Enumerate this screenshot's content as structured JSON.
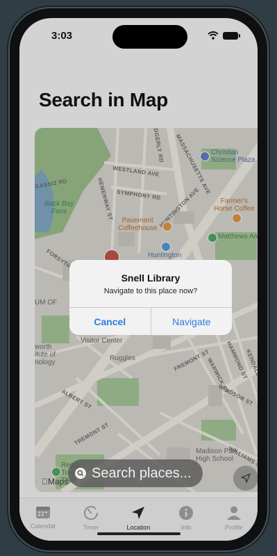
{
  "status_bar": {
    "time": "3:03"
  },
  "page": {
    "title": "Search in Map"
  },
  "map": {
    "attribution": "Maps",
    "streets": [
      "MASSACHUSETTS AVE",
      "HUNTINGTON AVE",
      "WESTLAND AVE",
      "SYMPHONY RD",
      "HEMENWAY ST",
      "EDGERLY RD",
      "FORSYTH WAY",
      "TREMONT ST",
      "FREMONT ST",
      "ALBERT ST",
      "WARWICK ST",
      "WINDSOR ST",
      "HAMMOND ST",
      "KENDALL ST",
      "WILLIAMS ST",
      "GASSIZ RD"
    ],
    "pois": {
      "christian_science_plaza": "Christian\nScience Plaza",
      "farmers_horse_coffee": "Farmer's\nHorse Coffee",
      "pavement_coffeehouse": "Pavement\nCoffeehouse",
      "matthews_arena": "Matthews Are",
      "huntington": "Huntington",
      "back_bay_fens": "Back Bay\nFens",
      "admissions": "Admissions\nVisitor Center",
      "institute": "worth\nitute of\nnology",
      "museum": "UM OF",
      "ruggles": "Ruggles",
      "madison_park": "Madison Park\nHigh School",
      "reggie": "Reggi\nTrack\nThlet"
    }
  },
  "search": {
    "placeholder": "Search places..."
  },
  "alert": {
    "title": "Snell Library",
    "message": "Navigate to this place now?",
    "cancel_label": "Cancel",
    "confirm_label": "Navigate"
  },
  "tabs": [
    {
      "label": "Calendar",
      "icon": "calendar-icon"
    },
    {
      "label": "Timer",
      "icon": "timer-icon"
    },
    {
      "label": "Location",
      "icon": "location-arrow-icon",
      "active": true
    },
    {
      "label": "Info",
      "icon": "info-icon"
    },
    {
      "label": "Profile",
      "icon": "profile-icon"
    }
  ],
  "colors": {
    "accent": "#2f7be0",
    "park": "#8fb97a",
    "water": "#6f9fbf",
    "road": "#f4f1e8"
  }
}
